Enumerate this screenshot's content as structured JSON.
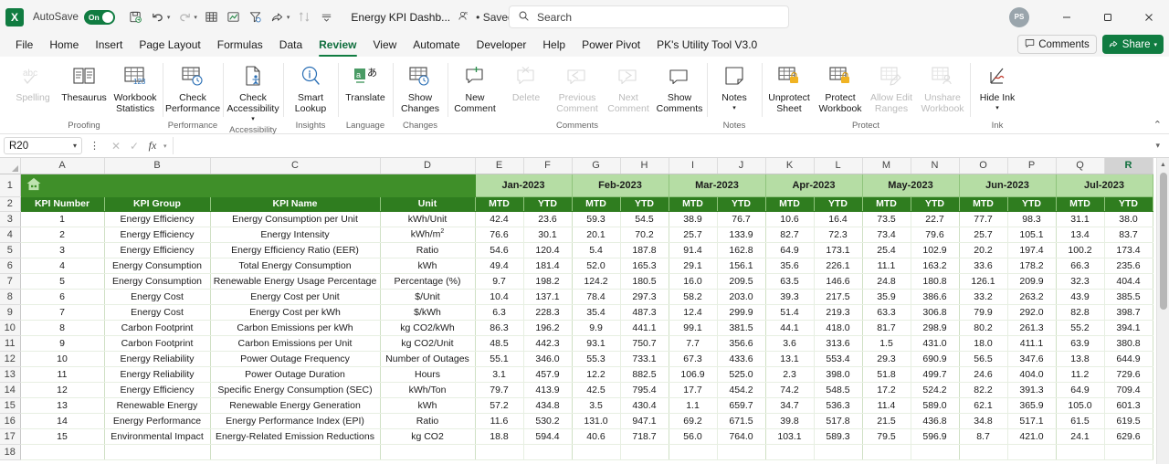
{
  "titlebar": {
    "app_logo": "excel-logo",
    "autosave_label": "AutoSave",
    "autosave_state": "On",
    "document_title": "Energy KPI Dashb...",
    "saved_state": "• Saved",
    "search_placeholder": "Search",
    "avatar_initials": "PS",
    "quick_access": [
      {
        "name": "save-icon",
        "glyph": "⭳"
      },
      {
        "name": "undo-icon",
        "glyph": "↶"
      },
      {
        "name": "redo-icon",
        "glyph": "↷"
      },
      {
        "name": "table-icon",
        "glyph": "⊞"
      },
      {
        "name": "chart-icon",
        "glyph": "Ὄ8"
      },
      {
        "name": "filter-icon",
        "glyph": "∇"
      },
      {
        "name": "share-icon",
        "glyph": "➦"
      },
      {
        "name": "sort-icon",
        "glyph": "↕"
      },
      {
        "name": "customize-qat-icon",
        "glyph": "⌄"
      }
    ],
    "window_buttons": [
      "minimize",
      "restore",
      "close"
    ]
  },
  "tabs": [
    {
      "label": "File",
      "active": false
    },
    {
      "label": "Home",
      "active": false
    },
    {
      "label": "Insert",
      "active": false
    },
    {
      "label": "Page Layout",
      "active": false
    },
    {
      "label": "Formulas",
      "active": false
    },
    {
      "label": "Data",
      "active": false
    },
    {
      "label": "Review",
      "active": true
    },
    {
      "label": "View",
      "active": false
    },
    {
      "label": "Automate",
      "active": false
    },
    {
      "label": "Developer",
      "active": false
    },
    {
      "label": "Help",
      "active": false
    },
    {
      "label": "Power Pivot",
      "active": false
    },
    {
      "label": "PK's Utility Tool V3.0",
      "active": false
    }
  ],
  "tab_right": {
    "comments_label": "Comments",
    "share_label": "Share"
  },
  "ribbon": {
    "groups": [
      {
        "label": "Proofing",
        "items": [
          {
            "name": "spelling-button",
            "label": "Spelling",
            "icon": "abc-check-icon",
            "disabled": true
          },
          {
            "name": "thesaurus-button",
            "label": "Thesaurus",
            "icon": "book-icon",
            "disabled": false
          },
          {
            "name": "workbook-statistics-button",
            "label": "Workbook Statistics",
            "icon": "table-123-icon",
            "disabled": false
          }
        ]
      },
      {
        "label": "Performance",
        "items": [
          {
            "name": "check-performance-button",
            "label": "Check Performance",
            "icon": "table-clock-icon",
            "disabled": false
          }
        ]
      },
      {
        "label": "Accessibility",
        "items": [
          {
            "name": "check-accessibility-button",
            "label": "Check Accessibility",
            "icon": "page-person-icon",
            "disabled": false,
            "dropdown": true
          }
        ]
      },
      {
        "label": "Insights",
        "items": [
          {
            "name": "smart-lookup-button",
            "label": "Smart Lookup",
            "icon": "magnifier-info-icon",
            "disabled": false
          }
        ]
      },
      {
        "label": "Language",
        "items": [
          {
            "name": "translate-button",
            "label": "Translate",
            "icon": "translate-icon",
            "disabled": false
          }
        ]
      },
      {
        "label": "Changes",
        "items": [
          {
            "name": "show-changes-button",
            "label": "Show Changes",
            "icon": "table-history-icon",
            "disabled": false
          }
        ]
      },
      {
        "label": "Comments",
        "items": [
          {
            "name": "new-comment-button",
            "label": "New Comment",
            "icon": "comment-plus-icon",
            "disabled": false
          },
          {
            "name": "delete-comment-button",
            "label": "Delete",
            "icon": "comment-x-icon",
            "disabled": true
          },
          {
            "name": "previous-comment-button",
            "label": "Previous Comment",
            "icon": "comment-left-icon",
            "disabled": true
          },
          {
            "name": "next-comment-button",
            "label": "Next Comment",
            "icon": "comment-right-icon",
            "disabled": true
          },
          {
            "name": "show-comments-button",
            "label": "Show Comments",
            "icon": "comment-icon",
            "disabled": false
          }
        ]
      },
      {
        "label": "Notes",
        "items": [
          {
            "name": "notes-button",
            "label": "Notes",
            "icon": "note-icon",
            "disabled": false,
            "dropdown": true
          }
        ]
      },
      {
        "label": "Protect",
        "items": [
          {
            "name": "unprotect-sheet-button",
            "label": "Unprotect Sheet",
            "icon": "sheet-lock-icon",
            "disabled": false
          },
          {
            "name": "protect-workbook-button",
            "label": "Protect Workbook",
            "icon": "workbook-lock-icon",
            "disabled": false
          },
          {
            "name": "allow-edit-ranges-button",
            "label": "Allow Edit Ranges",
            "icon": "pencil-sheet-icon",
            "disabled": true
          },
          {
            "name": "unshare-workbook-button",
            "label": "Unshare Workbook",
            "icon": "person-sheet-icon",
            "disabled": true
          }
        ]
      },
      {
        "label": "Ink",
        "items": [
          {
            "name": "hide-ink-button",
            "label": "Hide Ink",
            "icon": "ink-icon",
            "disabled": false,
            "dropdown": true
          }
        ]
      }
    ]
  },
  "formula_bar": {
    "name_box": "R20",
    "formula_value": "",
    "cancel_icon": "x-icon",
    "confirm_icon": "check-icon",
    "fx_icon": "fx-icon"
  },
  "grid": {
    "column_headers": [
      "A",
      "B",
      "C",
      "D",
      "E",
      "F",
      "G",
      "H",
      "I",
      "J",
      "K",
      "L",
      "M",
      "N",
      "O",
      "P",
      "Q",
      "R"
    ],
    "selected_column": "R",
    "row_headers": [
      "1",
      "2",
      "3",
      "4",
      "5",
      "6",
      "7",
      "8",
      "9",
      "10",
      "11",
      "12",
      "13",
      "14",
      "15",
      "16",
      "17",
      "18"
    ],
    "banner_icon": "home-icon",
    "left_headers": [
      "KPI Number",
      "KPI Group",
      "KPI Name",
      "Unit"
    ],
    "months": [
      "Jan-2023",
      "Feb-2023",
      "Mar-2023",
      "Apr-2023",
      "May-2023",
      "Jun-2023",
      "Jul-2023"
    ],
    "sub_headers": [
      "MTD",
      "YTD"
    ],
    "rows": [
      {
        "num": "1",
        "group": "Energy Efficiency",
        "name": "Energy Consumption per Unit",
        "unit": "kWh/Unit",
        "vals": [
          "42.4",
          "23.6",
          "59.3",
          "54.5",
          "38.9",
          "76.7",
          "10.6",
          "16.4",
          "73.5",
          "22.7",
          "77.7",
          "98.3",
          "31.1",
          "38.0"
        ]
      },
      {
        "num": "2",
        "group": "Energy Efficiency",
        "name": "Energy Intensity",
        "unit": "kWh/m²",
        "vals": [
          "76.6",
          "30.1",
          "20.1",
          "70.2",
          "25.7",
          "133.9",
          "82.7",
          "72.3",
          "73.4",
          "79.6",
          "25.7",
          "105.1",
          "13.4",
          "83.7"
        ]
      },
      {
        "num": "3",
        "group": "Energy Efficiency",
        "name": "Energy Efficiency Ratio (EER)",
        "unit": "Ratio",
        "vals": [
          "54.6",
          "120.4",
          "5.4",
          "187.8",
          "91.4",
          "162.8",
          "64.9",
          "173.1",
          "25.4",
          "102.9",
          "20.2",
          "197.4",
          "100.2",
          "173.4"
        ]
      },
      {
        "num": "4",
        "group": "Energy Consumption",
        "name": "Total Energy Consumption",
        "unit": "kWh",
        "vals": [
          "49.4",
          "181.4",
          "52.0",
          "165.3",
          "29.1",
          "156.1",
          "35.6",
          "226.1",
          "11.1",
          "163.2",
          "33.6",
          "178.2",
          "66.3",
          "235.6"
        ]
      },
      {
        "num": "5",
        "group": "Energy Consumption",
        "name": "Renewable Energy Usage Percentage",
        "unit": "Percentage (%)",
        "vals": [
          "9.7",
          "198.2",
          "124.2",
          "180.5",
          "16.0",
          "209.5",
          "63.5",
          "146.6",
          "24.8",
          "180.8",
          "126.1",
          "209.9",
          "32.3",
          "404.4"
        ]
      },
      {
        "num": "6",
        "group": "Energy Cost",
        "name": "Energy Cost per Unit",
        "unit": "$/Unit",
        "vals": [
          "10.4",
          "137.1",
          "78.4",
          "297.3",
          "58.2",
          "203.0",
          "39.3",
          "217.5",
          "35.9",
          "386.6",
          "33.2",
          "263.2",
          "43.9",
          "385.5"
        ]
      },
      {
        "num": "7",
        "group": "Energy Cost",
        "name": "Energy Cost per kWh",
        "unit": "$/kWh",
        "vals": [
          "6.3",
          "228.3",
          "35.4",
          "487.3",
          "12.4",
          "299.9",
          "51.4",
          "219.3",
          "63.3",
          "306.8",
          "79.9",
          "292.0",
          "82.8",
          "398.7"
        ]
      },
      {
        "num": "8",
        "group": "Carbon Footprint",
        "name": "Carbon Emissions per kWh",
        "unit": "kg CO2/kWh",
        "vals": [
          "86.3",
          "196.2",
          "9.9",
          "441.1",
          "99.1",
          "381.5",
          "44.1",
          "418.0",
          "81.7",
          "298.9",
          "80.2",
          "261.3",
          "55.2",
          "394.1"
        ]
      },
      {
        "num": "9",
        "group": "Carbon Footprint",
        "name": "Carbon Emissions per Unit",
        "unit": "kg CO2/Unit",
        "vals": [
          "48.5",
          "442.3",
          "93.1",
          "750.7",
          "7.7",
          "356.6",
          "3.6",
          "313.6",
          "1.5",
          "431.0",
          "18.0",
          "411.1",
          "63.9",
          "380.8"
        ]
      },
      {
        "num": "10",
        "group": "Energy Reliability",
        "name": "Power Outage Frequency",
        "unit": "Number of Outages",
        "vals": [
          "55.1",
          "346.0",
          "55.3",
          "733.1",
          "67.3",
          "433.6",
          "13.1",
          "553.4",
          "29.3",
          "690.9",
          "56.5",
          "347.6",
          "13.8",
          "644.9"
        ]
      },
      {
        "num": "11",
        "group": "Energy Reliability",
        "name": "Power Outage Duration",
        "unit": "Hours",
        "vals": [
          "3.1",
          "457.9",
          "12.2",
          "882.5",
          "106.9",
          "525.0",
          "2.3",
          "398.0",
          "51.8",
          "499.7",
          "24.6",
          "404.0",
          "11.2",
          "729.6"
        ]
      },
      {
        "num": "12",
        "group": "Energy Efficiency",
        "name": "Specific Energy Consumption (SEC)",
        "unit": "kWh/Ton",
        "vals": [
          "79.7",
          "413.9",
          "42.5",
          "795.4",
          "17.7",
          "454.2",
          "74.2",
          "548.5",
          "17.2",
          "524.2",
          "82.2",
          "391.3",
          "64.9",
          "709.4"
        ]
      },
      {
        "num": "13",
        "group": "Renewable Energy",
        "name": "Renewable Energy Generation",
        "unit": "kWh",
        "vals": [
          "57.2",
          "434.8",
          "3.5",
          "430.4",
          "1.1",
          "659.7",
          "34.7",
          "536.3",
          "11.4",
          "589.0",
          "62.1",
          "365.9",
          "105.0",
          "601.3"
        ]
      },
      {
        "num": "14",
        "group": "Energy Performance",
        "name": "Energy Performance Index (EPI)",
        "unit": "Ratio",
        "vals": [
          "11.6",
          "530.2",
          "131.0",
          "947.1",
          "69.2",
          "671.5",
          "39.8",
          "517.8",
          "21.5",
          "436.8",
          "34.8",
          "517.1",
          "61.5",
          "619.5"
        ]
      },
      {
        "num": "15",
        "group": "Environmental Impact",
        "name": "Energy-Related Emission Reductions",
        "unit": "kg CO2",
        "vals": [
          "18.8",
          "594.4",
          "40.6",
          "718.7",
          "56.0",
          "764.0",
          "103.1",
          "589.3",
          "79.5",
          "596.9",
          "8.7",
          "421.0",
          "24.1",
          "629.6"
        ]
      }
    ]
  }
}
